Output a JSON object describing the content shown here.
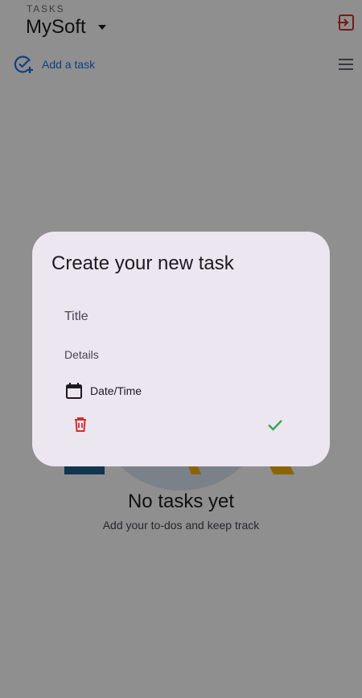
{
  "header": {
    "section_label": "TASKS",
    "list_name": "MySoft"
  },
  "toolbar": {
    "add_task_label": "Add a task"
  },
  "empty_state": {
    "title": "No tasks yet",
    "subtitle": "Add your to-dos and keep track"
  },
  "dialog": {
    "title": "Create your new task",
    "title_placeholder": "Title",
    "details_placeholder": "Details",
    "datetime_label": "Date/Time"
  },
  "colors": {
    "accent": "#1a73e8",
    "danger": "#d32f2f",
    "success": "#34a853",
    "dialog_bg": "#ece6f0"
  }
}
